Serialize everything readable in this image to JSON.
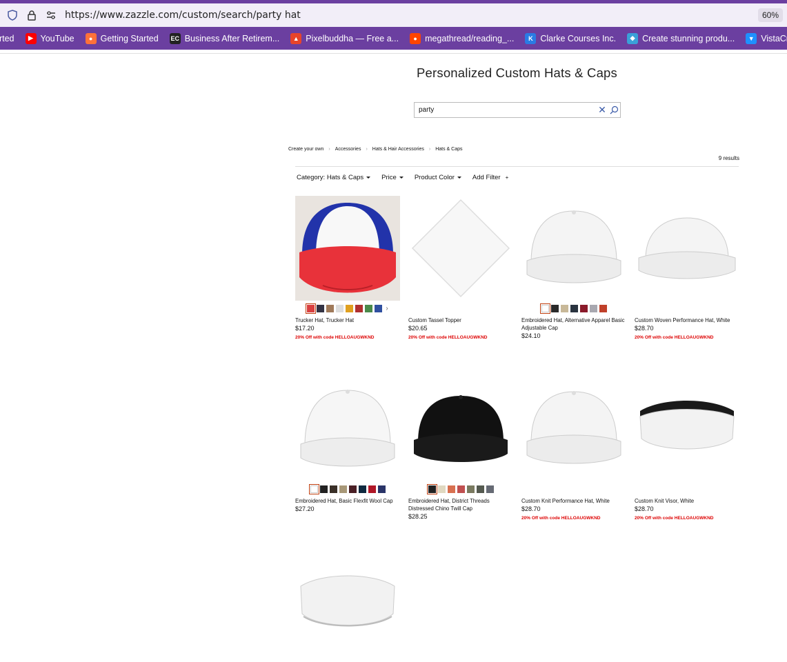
{
  "browser": {
    "url": "https://www.zazzle.com/custom/search/party hat",
    "zoom": "60%",
    "bookmarks": [
      {
        "label": "arted",
        "color": "#6b3fa0",
        "glyph": ""
      },
      {
        "label": "YouTube",
        "color": "#ff0000",
        "glyph": "▶"
      },
      {
        "label": "Getting Started",
        "color": "#ff7139",
        "glyph": "●"
      },
      {
        "label": "Business After Retirem...",
        "color": "#222222",
        "glyph": "EC"
      },
      {
        "label": "Pixelbuddha — Free a...",
        "color": "#e8442a",
        "glyph": "▲"
      },
      {
        "label": "megathread/reading_...",
        "color": "#ff4500",
        "glyph": "●"
      },
      {
        "label": "Clarke Courses Inc.",
        "color": "#2a7be4",
        "glyph": "K"
      },
      {
        "label": "Create stunning produ...",
        "color": "#3aa0d8",
        "glyph": "◆"
      },
      {
        "label": "VistaCreate – Free Gra...",
        "color": "#1e90ff",
        "glyph": "▼"
      }
    ]
  },
  "page": {
    "title": "Personalized Custom Hats & Caps",
    "search_value": "party",
    "breadcrumbs": [
      "Create your own",
      "Accessories",
      "Hats & Hair Accessories",
      "Hats & Caps"
    ],
    "results": "9 results",
    "filters": [
      "Category: Hats & Caps",
      "Price",
      "Product Color",
      "Add Filter"
    ]
  },
  "products": [
    {
      "name": "Trucker Hat, Trucker Hat",
      "price": "$17.20",
      "promo": "20% Off with code HELLOAUGWKND",
      "swatches": [
        "#d94040",
        "#333344",
        "#a07a5a",
        "#dddddd",
        "#e0a020",
        "#b03030",
        "#4a8a4a",
        "#3050a0"
      ],
      "swatch_style": "mini-hat",
      "image": "trucker"
    },
    {
      "name": "Custom Tassel Topper",
      "price": "$20.65",
      "promo": "20% Off with code HELLOAUGWKND",
      "swatches": [],
      "image": "diamond"
    },
    {
      "name": "Embroidered Hat, Alternative Apparel Basic Adjustable Cap",
      "price": "$24.10",
      "promo": "",
      "swatches": [
        "#ffffff",
        "#2a2a2a",
        "#c8b898",
        "#2a3440",
        "#8a1a2a",
        "#a8a8b0",
        "#c0402a"
      ],
      "image": "cap-white"
    },
    {
      "name": "Custom Woven Performance Hat, White",
      "price": "$28.70",
      "promo": "20% Off with code HELLOAUGWKND",
      "swatches": [],
      "image": "cap-low"
    },
    {
      "name": "Embroidered Hat, Basic Flexfit Wool Cap",
      "price": "$27.20",
      "promo": "",
      "swatches": [
        "#ffffff",
        "#222222",
        "#3a3028",
        "#a89878",
        "#4a2026",
        "#102a40",
        "#b01828",
        "#2a3468"
      ],
      "image": "cap-flex"
    },
    {
      "name": "Embroidered Hat, District Threads Distressed Chino Twill Cap",
      "price": "$28.25",
      "promo": "",
      "swatches": [
        "#222222",
        "#e0d8c0",
        "#d87050",
        "#c05050",
        "#7a7a60",
        "#555a50",
        "#666a74"
      ],
      "image": "cap-black"
    },
    {
      "name": "Custom Knit Performance Hat, White",
      "price": "$28.70",
      "promo": "20% Off with code HELLOAUGWKND",
      "swatches": [],
      "image": "cap-white"
    },
    {
      "name": "Custom Knit Visor, White",
      "price": "$28.70",
      "promo": "20% Off with code HELLOAUGWKND",
      "swatches": [],
      "image": "visor-black"
    },
    {
      "name": "",
      "price": "",
      "promo": "",
      "swatches": [],
      "image": "visor-white"
    }
  ]
}
